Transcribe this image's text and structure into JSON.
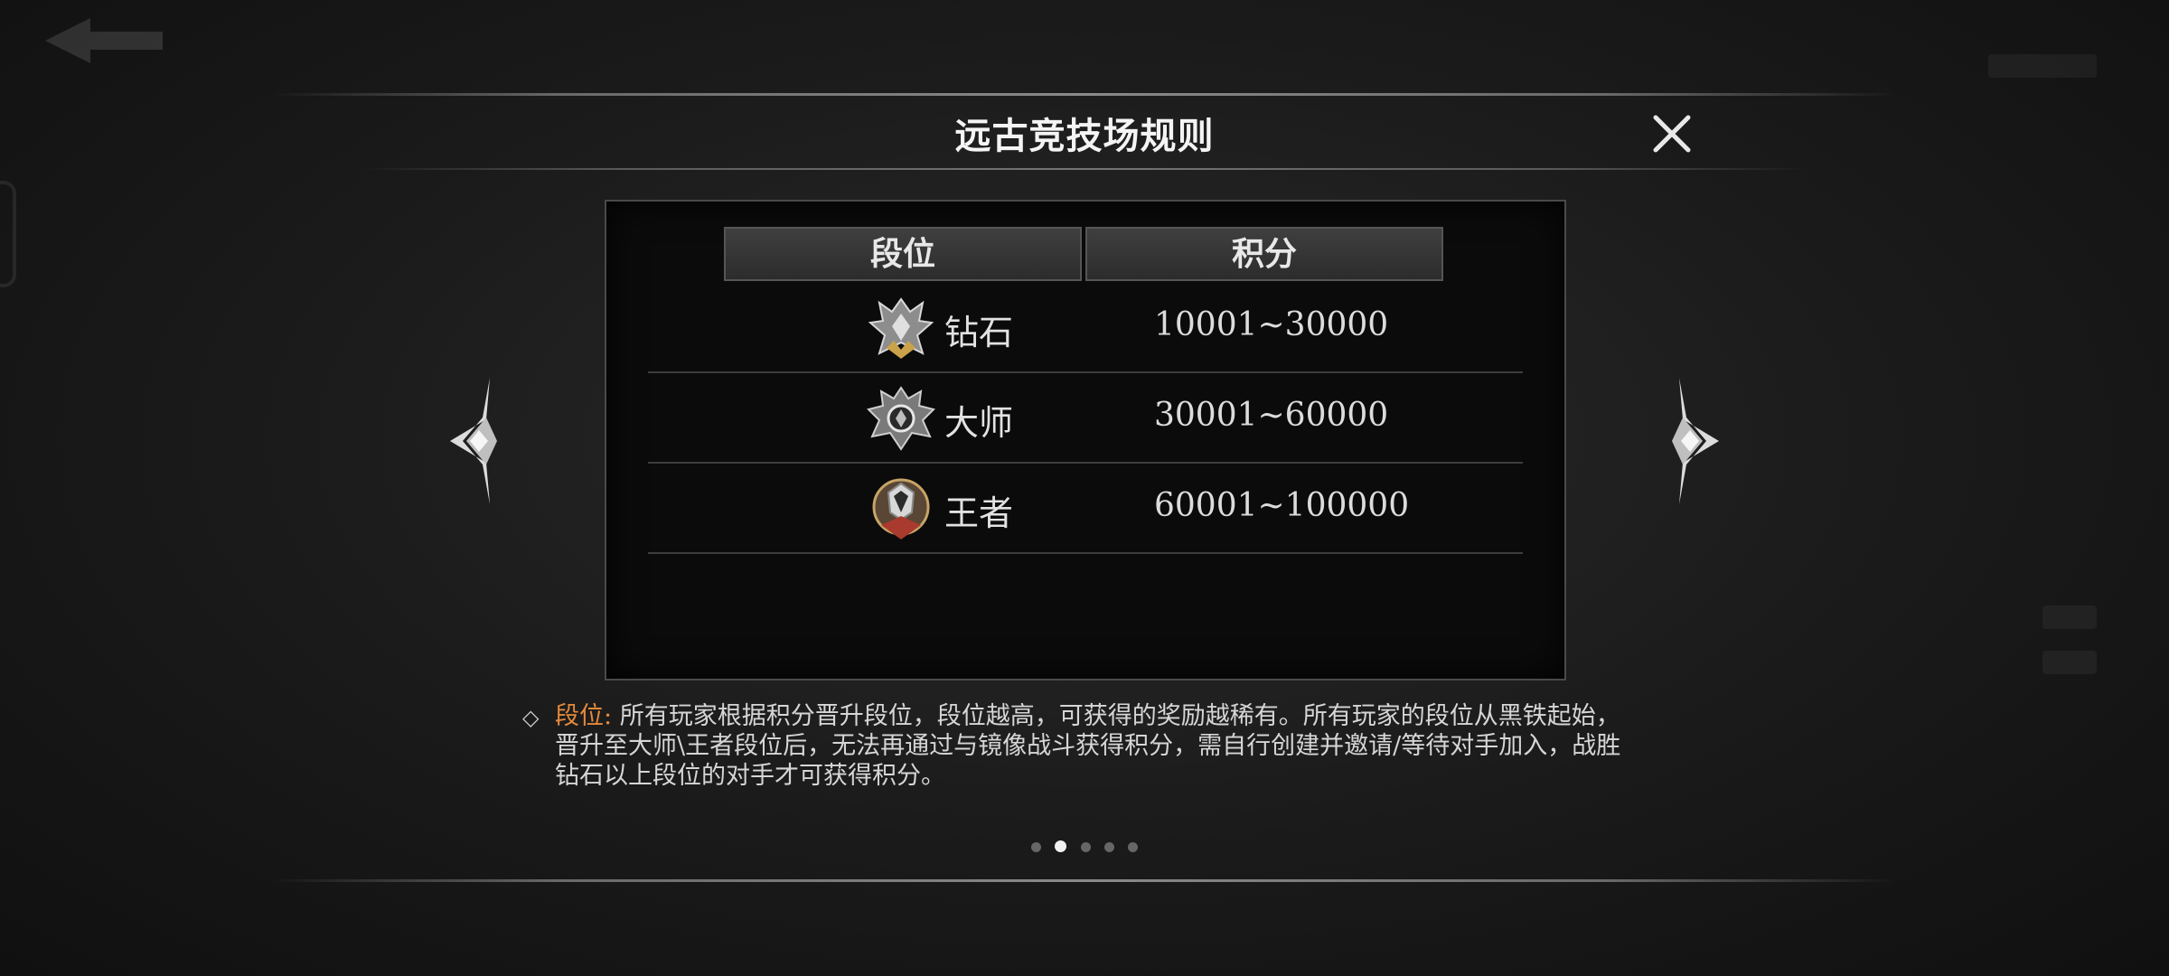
{
  "dialog": {
    "title": "远古竞技场规则",
    "table": {
      "headers": [
        "段位",
        "积分"
      ],
      "rows": [
        {
          "rank": "钻石",
          "score": "10001~30000",
          "icon": "diamond-rank-icon"
        },
        {
          "rank": "大师",
          "score": "30001~60000",
          "icon": "master-rank-icon"
        },
        {
          "rank": "王者",
          "score": "60001~100000",
          "icon": "king-rank-icon"
        }
      ]
    },
    "description": {
      "label": "段位:",
      "text": "所有玩家根据积分晋升段位，段位越高，可获得的奖励越稀有。所有玩家的段位从黑铁起始，晋升至大师\\王者段位后，无法再通过与镜像战斗获得积分，需自行创建并邀请/等待对手加入，战胜钻石以上段位的对手才可获得积分。"
    },
    "pagination": {
      "total": 5,
      "current": 2
    }
  },
  "icons": {
    "close": "close-icon",
    "prev": "left-arrow-icon",
    "next": "right-arrow-icon",
    "bullet": "diamond-bullet-icon"
  },
  "colors": {
    "label_accent": "#e58a3c",
    "text": "#d6d6d6",
    "active_dot": "#f2f2f2"
  }
}
